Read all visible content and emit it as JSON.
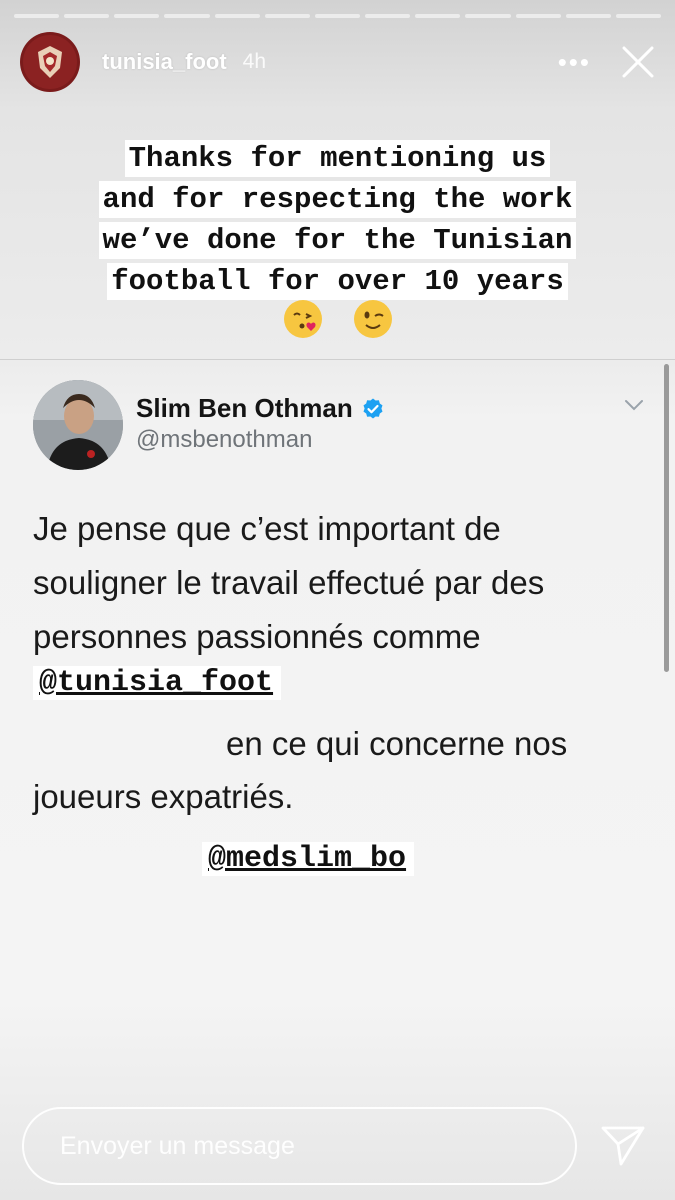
{
  "header": {
    "username": "tunisia_foot",
    "time": "4h",
    "more_label": "•••",
    "progress_total": 13,
    "progress_done": 0
  },
  "caption": {
    "lines": [
      "Thanks for mentioning us",
      "and for respecting the work",
      "we’ve done for the Tunisian",
      "football for over 10 years"
    ],
    "emojis": [
      "face-blowing-kiss",
      "winking-face"
    ]
  },
  "tweet": {
    "name": "Slim Ben Othman",
    "verified": true,
    "handle": "@msbenothman",
    "text_line_1": "Je pense que c’est important de",
    "text_line_2": "souligner le travail effectué par des",
    "text_line_3": "personnes passionnés comme",
    "text_line_4": "en ce qui concerne nos",
    "text_line_5": "joueurs expatriés."
  },
  "mentions": {
    "first": "@tunisia_foot",
    "second": "@medslim_bo"
  },
  "message_bar": {
    "placeholder": "Envoyer un message"
  },
  "colors": {
    "verified_blue": "#1DA1F2",
    "avatar_maroon": "#7a1b1b"
  }
}
